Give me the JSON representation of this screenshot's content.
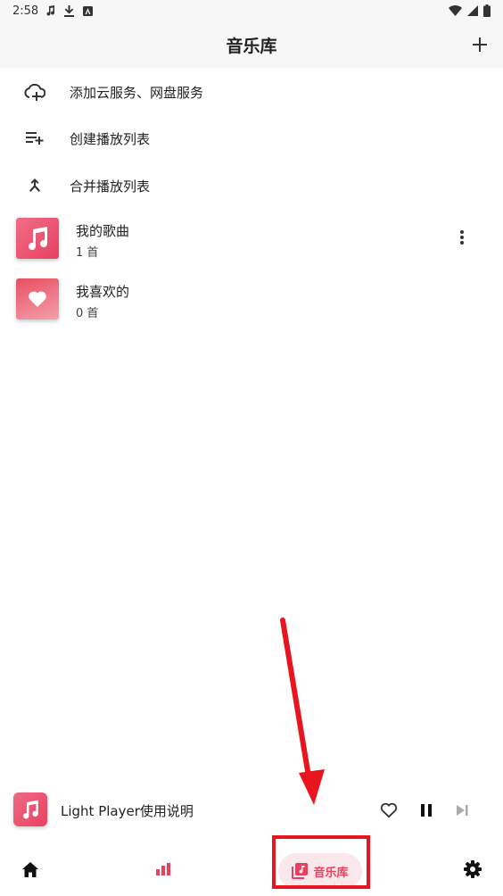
{
  "status_bar": {
    "time": "2:58",
    "notification_icons": [
      "music-note-icon",
      "download-icon",
      "app-notification-icon"
    ],
    "system_icons": [
      "wifi-icon",
      "signal-icon",
      "battery-icon"
    ]
  },
  "app_bar": {
    "title": "音乐库",
    "action_icon": "plus-icon"
  },
  "actions": [
    {
      "label": "添加云服务、网盘服务",
      "icon": "cloud-add-icon"
    },
    {
      "label": "创建播放列表",
      "icon": "playlist-add-icon"
    },
    {
      "label": "合并播放列表",
      "icon": "merge-icon"
    }
  ],
  "playlists": [
    {
      "name": "我的歌曲",
      "count": "1 首",
      "icon": "music-note-icon",
      "has_menu": true
    },
    {
      "name": "我喜欢的",
      "count": "0 首",
      "icon": "heart-icon",
      "has_menu": false
    }
  ],
  "mini_player": {
    "song_title": "Light Player使用说明",
    "controls": [
      "heart-outline-icon",
      "pause-icon",
      "skip-next-icon"
    ]
  },
  "bottom_nav": {
    "items": [
      {
        "icon": "home-icon",
        "label": ""
      },
      {
        "icon": "bar-chart-icon",
        "label": ""
      },
      {
        "icon": "library-music-icon",
        "label": "音乐库",
        "active": true
      },
      {
        "icon": "settings-icon",
        "label": ""
      }
    ]
  },
  "colors": {
    "accent": "#e8405e",
    "annotation": "#e8141e",
    "header_bg": "#f7f7f7"
  }
}
